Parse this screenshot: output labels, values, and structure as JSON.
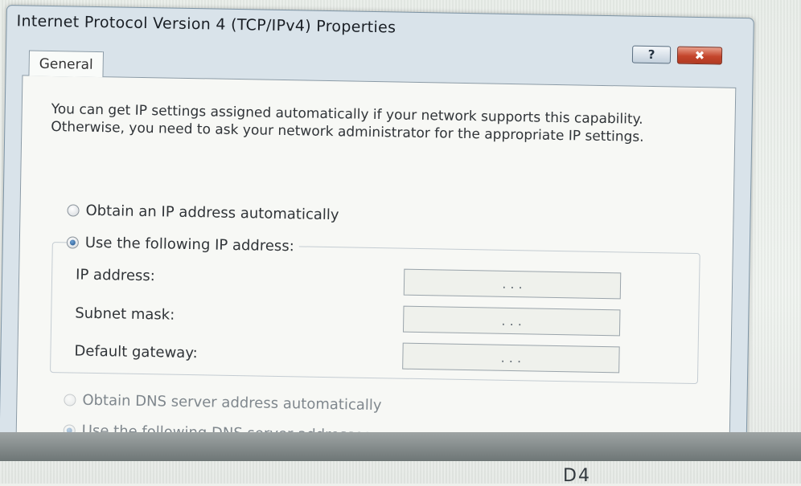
{
  "dialog": {
    "title": "Internet Protocol Version 4 (TCP/IPv4) Properties",
    "help_label": "?",
    "close_label": "✖"
  },
  "tabs": [
    {
      "label": "General"
    }
  ],
  "general": {
    "intro": "You can get IP settings assigned automatically if your network supports this capability. Otherwise, you need to ask your network administrator for the appropriate IP settings.",
    "radio_obtain_ip": {
      "label": "Obtain an IP address automatically",
      "checked": false
    },
    "radio_use_ip": {
      "label": "Use the following IP address:",
      "checked": true
    },
    "fields": [
      {
        "label": "IP address:",
        "value": ".      .      ."
      },
      {
        "label": "Subnet mask:",
        "value": ".      .      ."
      },
      {
        "label": "Default gateway:",
        "value": ".      .      ."
      }
    ],
    "radio_obtain_dns": {
      "label": "Obtain DNS server address automatically",
      "checked": false,
      "disabled": true
    },
    "radio_use_dns": {
      "label": "Use the following DNS server addresses:",
      "checked": true,
      "disabled": true
    }
  },
  "background": {
    "partial_text": "D4"
  },
  "colors": {
    "dialog_frame": "#d9e3ea",
    "close_button": "#c4452c",
    "panel": "#f7f8f5"
  }
}
